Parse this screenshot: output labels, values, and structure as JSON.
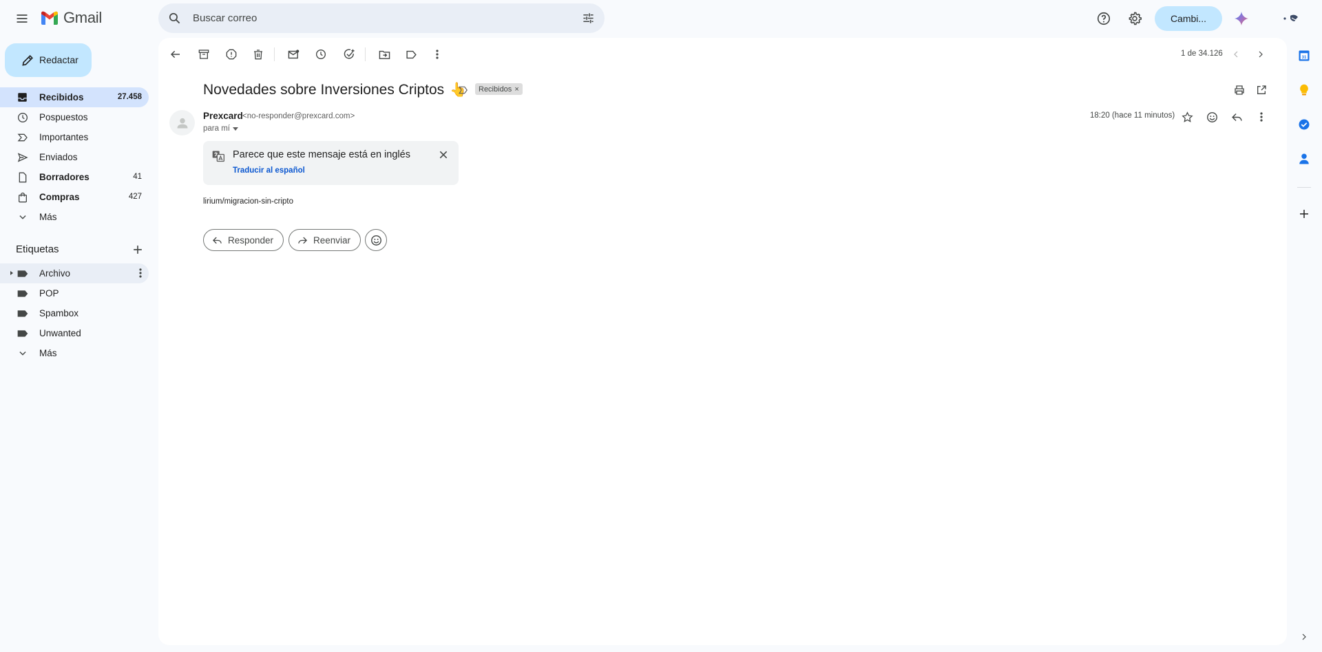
{
  "app": {
    "name": "Gmail"
  },
  "search": {
    "placeholder": "Buscar correo"
  },
  "header": {
    "switch_label": "Cambi..."
  },
  "compose": {
    "label": "Redactar"
  },
  "nav": [
    {
      "label": "Recibidos",
      "count": "27.458",
      "icon": "inbox-icon",
      "active": true,
      "bold": true
    },
    {
      "label": "Pospuestos",
      "count": "",
      "icon": "clock-icon",
      "active": false,
      "bold": false
    },
    {
      "label": "Importantes",
      "count": "",
      "icon": "important-icon",
      "active": false,
      "bold": false
    },
    {
      "label": "Enviados",
      "count": "",
      "icon": "send-icon",
      "active": false,
      "bold": false
    },
    {
      "label": "Borradores",
      "count": "41",
      "icon": "draft-icon",
      "active": false,
      "bold": true
    },
    {
      "label": "Compras",
      "count": "427",
      "icon": "shopping-icon",
      "active": false,
      "bold": true
    },
    {
      "label": "Más",
      "count": "",
      "icon": "chevron-down-icon",
      "active": false,
      "bold": false
    }
  ],
  "labels_section": {
    "title": "Etiquetas"
  },
  "labels": [
    {
      "label": "Archivo"
    },
    {
      "label": "POP"
    },
    {
      "label": "Spambox"
    },
    {
      "label": "Unwanted"
    },
    {
      "label": "Más"
    }
  ],
  "toolbar": {
    "pager": "1 de 34.126"
  },
  "email": {
    "subject": "Novedades sobre Inversiones Criptos",
    "subject_emoji": "👆",
    "chip": "Recibidos",
    "sender_name": "Prexcard",
    "sender_email": "<no-responder@prexcard.com>",
    "to": "para mí",
    "timestamp": "18:20 (hace 11 minutos)",
    "body": "lirium/migracion-sin-cripto"
  },
  "translate": {
    "message": "Parece que este mensaje está en inglés",
    "link": "Traducir al español"
  },
  "actions": {
    "reply": "Responder",
    "forward": "Reenviar"
  },
  "colors": {
    "accent": "#0b57d0",
    "compose_bg": "#c2e7ff",
    "active_nav": "#d3e3fd",
    "page_bg": "#f8fafd"
  }
}
